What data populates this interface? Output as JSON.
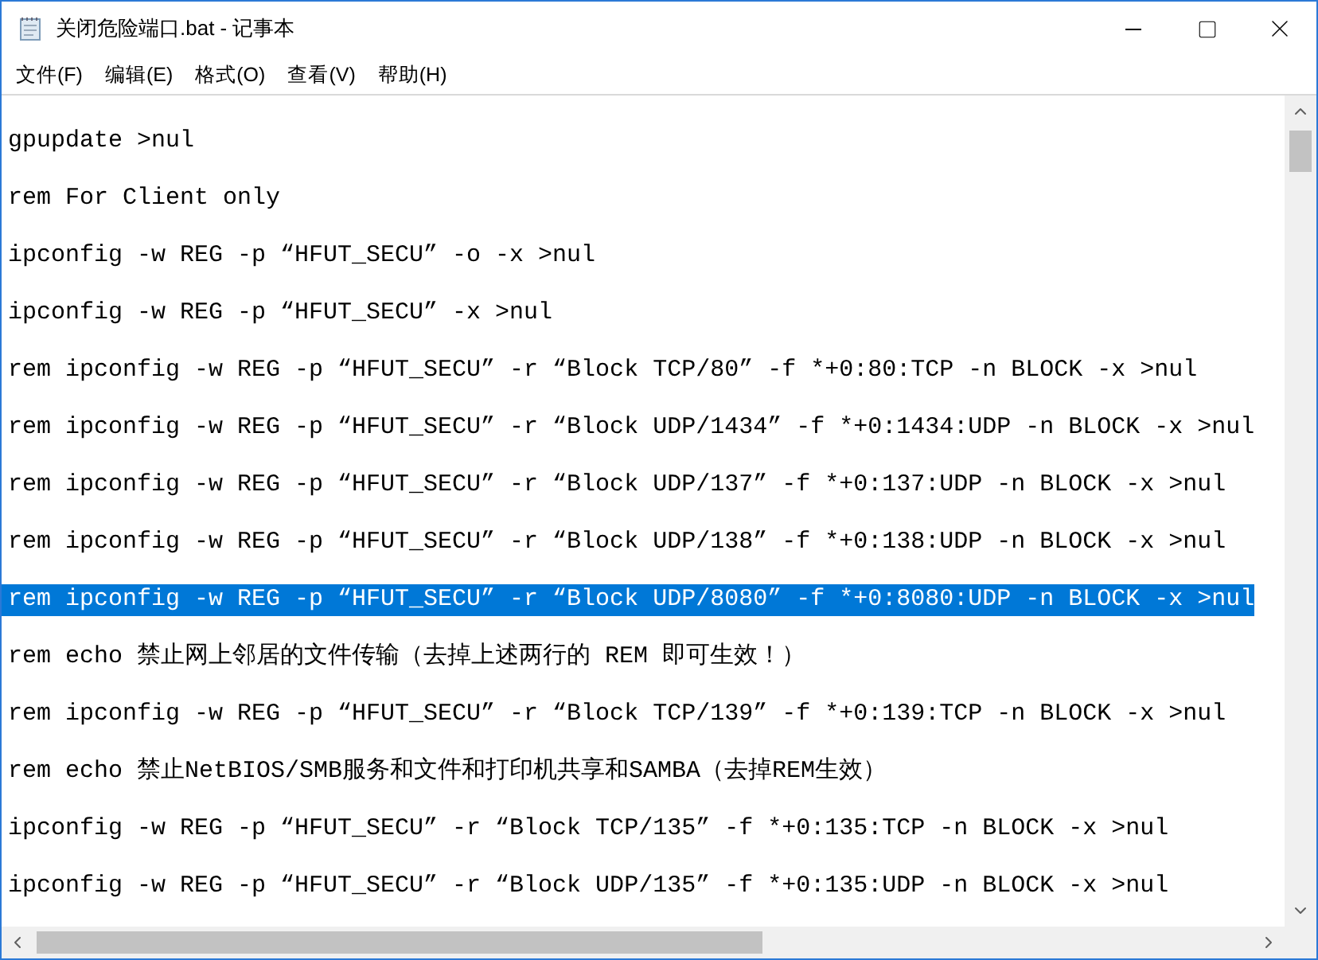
{
  "window": {
    "title": "关闭危险端口.bat - 记事本"
  },
  "menu": [
    "文件(F)",
    "编辑(E)",
    "格式(O)",
    "查看(V)",
    "帮助(H)"
  ],
  "lines": [
    {
      "text": "gpupdate >nul",
      "selected": false
    },
    {
      "text": "rem For Client only",
      "selected": false
    },
    {
      "text": "ipconfig -w REG -p “HFUT_SECU” -o -x >nul",
      "selected": false
    },
    {
      "text": "ipconfig -w REG -p “HFUT_SECU” -x >nul",
      "selected": false
    },
    {
      "text": "rem ipconfig -w REG -p “HFUT_SECU” -r “Block TCP/80” -f *+0:80:TCP -n BLOCK -x >nul",
      "selected": false
    },
    {
      "text": "rem ipconfig -w REG -p “HFUT_SECU” -r “Block UDP/1434” -f *+0:1434:UDP -n BLOCK -x >nul",
      "selected": false
    },
    {
      "text": "rem ipconfig -w REG -p “HFUT_SECU” -r “Block UDP/137” -f *+0:137:UDP -n BLOCK -x >nul",
      "selected": false
    },
    {
      "text": "rem ipconfig -w REG -p “HFUT_SECU” -r “Block UDP/138” -f *+0:138:UDP -n BLOCK -x >nul",
      "selected": false
    },
    {
      "text": "rem ipconfig -w REG -p “HFUT_SECU” -r “Block UDP/8080” -f *+0:8080:UDP -n BLOCK -x >nul",
      "selected": true
    },
    {
      "text": "rem echo 禁止网上邻居的文件传输（去掉上述两行的 REM 即可生效！）",
      "selected": false
    },
    {
      "text": "rem ipconfig -w REG -p “HFUT_SECU” -r “Block TCP/139” -f *+0:139:TCP -n BLOCK -x >nul",
      "selected": false
    },
    {
      "text": "rem echo 禁止NetBIOS/SMB服务和文件和打印机共享和SAMBA（去掉REM生效）",
      "selected": false
    },
    {
      "text": "ipconfig -w REG -p “HFUT_SECU” -r “Block TCP/135” -f *+0:135:TCP -n BLOCK -x >nul",
      "selected": false
    },
    {
      "text": "ipconfig -w REG -p “HFUT_SECU” -r “Block UDP/135” -f *+0:135:UDP -n BLOCK -x >nul",
      "selected": false
    }
  ]
}
